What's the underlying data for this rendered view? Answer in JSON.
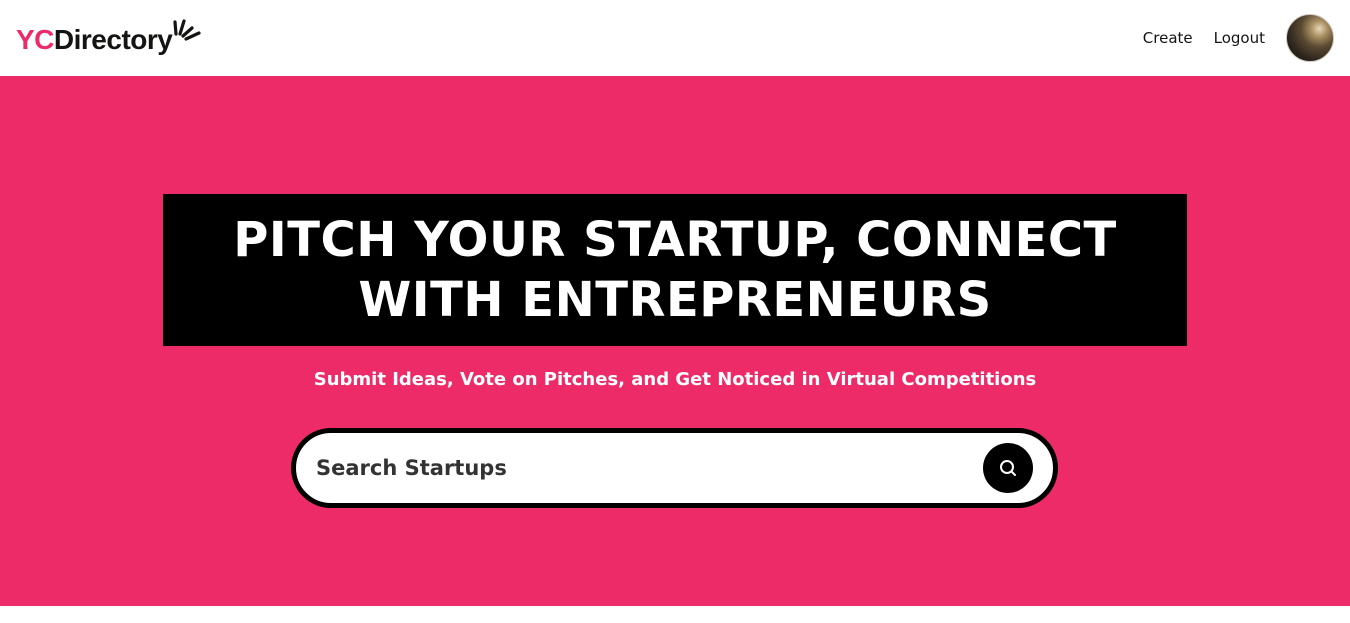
{
  "brand": {
    "logo_yc": "YC",
    "logo_directory": "Directory",
    "accent_color": "#EE2B69"
  },
  "nav": {
    "create_label": "Create",
    "logout_label": "Logout",
    "avatar_icon": "user-avatar"
  },
  "hero": {
    "headline_line1": "PITCH YOUR STARTUP, CONNECT",
    "headline_line2": "WITH ENTREPRENEURS",
    "subtitle": "Submit Ideas, Vote on Pitches, and Get Noticed in Virtual Competitions",
    "background_color": "#EE2B69"
  },
  "search": {
    "placeholder": "Search Startups",
    "value": "",
    "button_icon": "search-icon"
  }
}
